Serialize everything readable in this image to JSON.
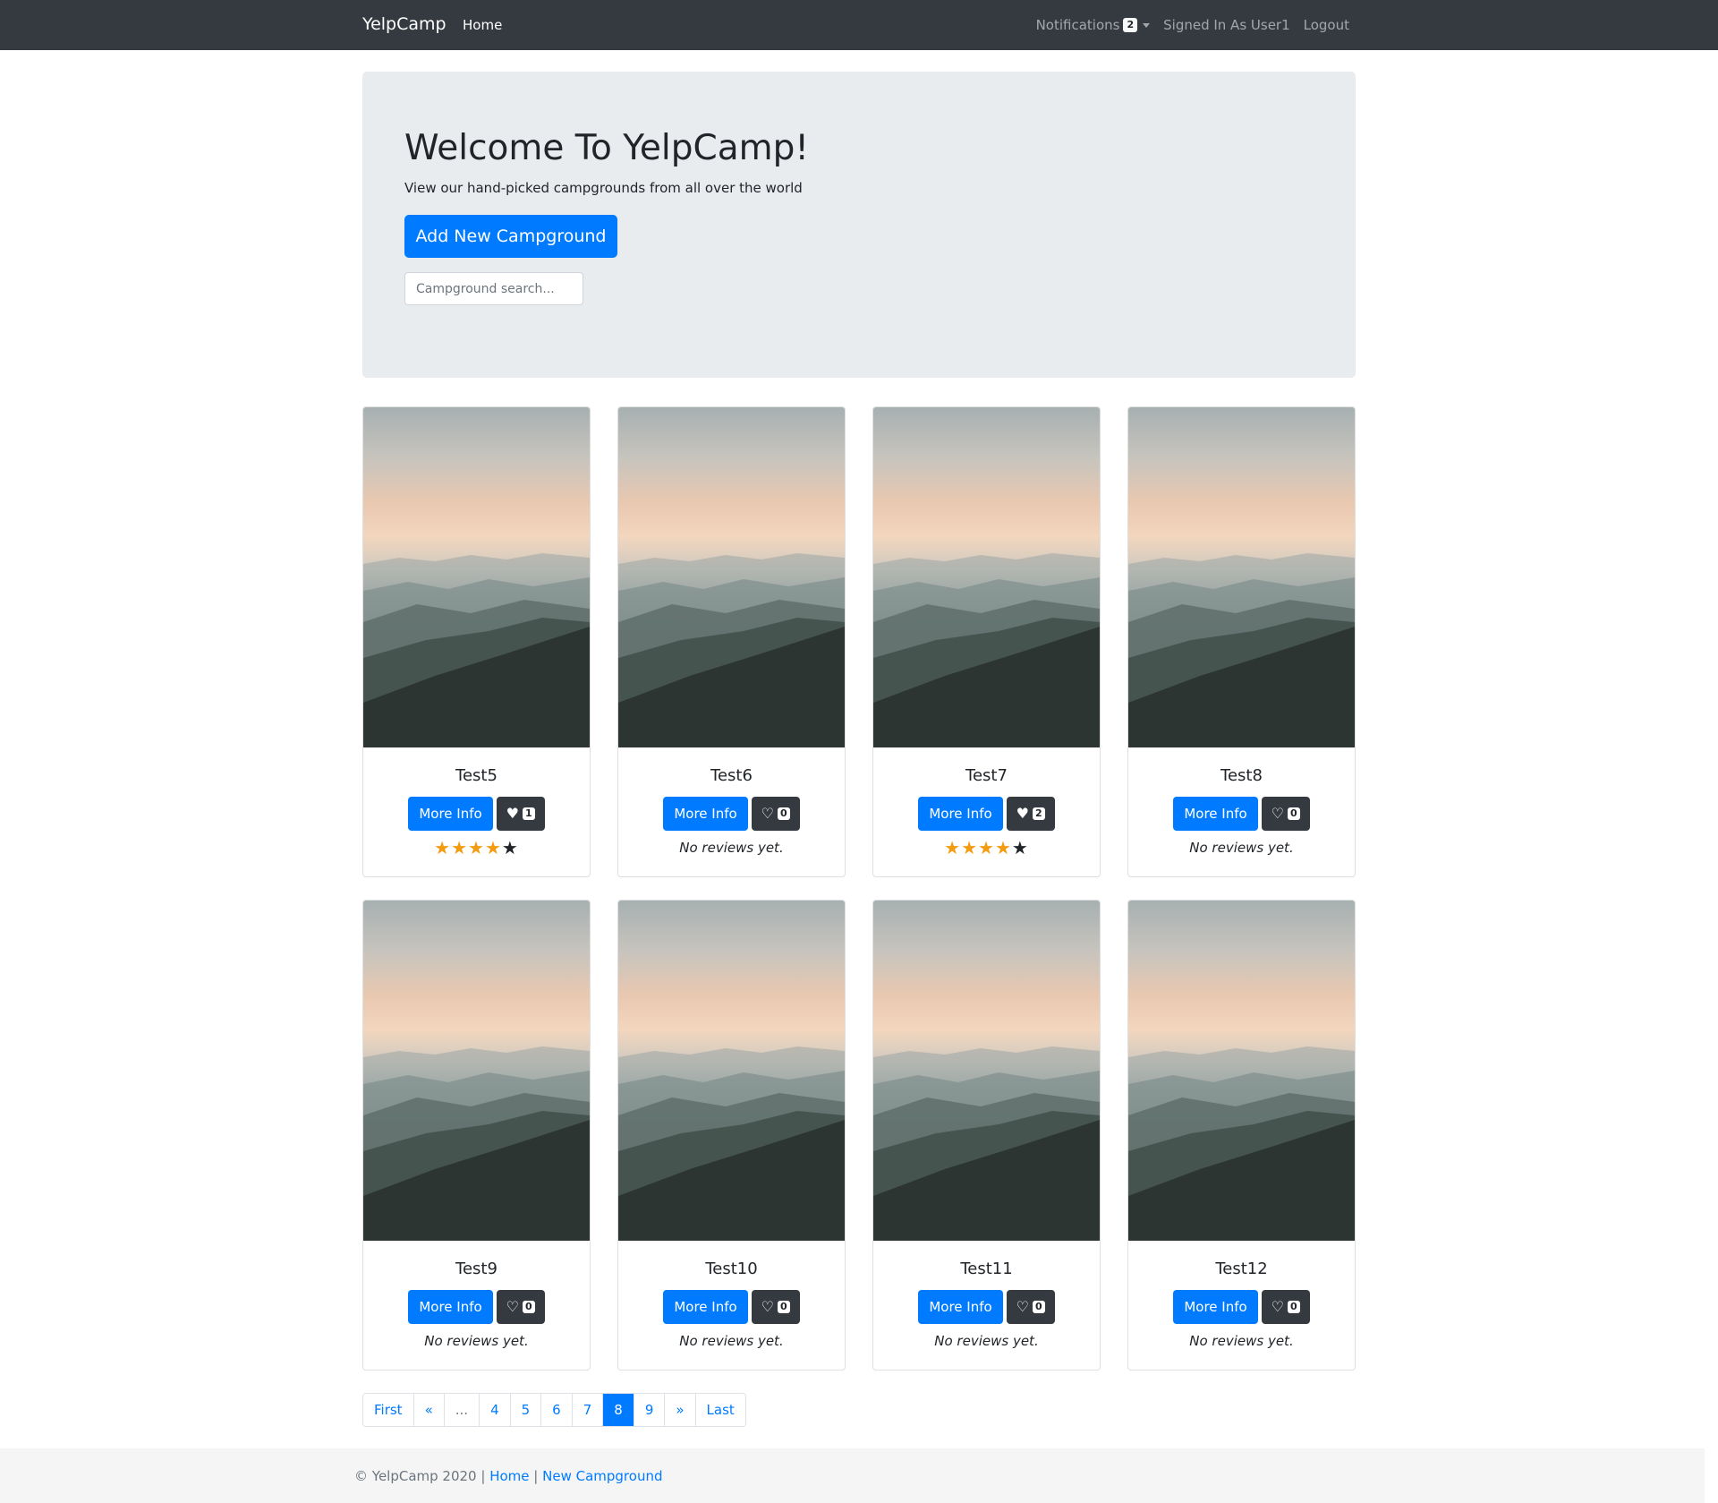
{
  "navbar": {
    "brand": "YelpCamp",
    "home": "Home",
    "notifications": "Notifications",
    "notification_count": "2",
    "signed_in": "Signed In As User1",
    "logout": "Logout"
  },
  "hero": {
    "title": "Welcome To YelpCamp!",
    "subtitle": "View our hand-picked campgrounds from all over the world",
    "add_button": "Add New Campground",
    "search_placeholder": "Campground search..."
  },
  "cards": [
    {
      "title": "Test5",
      "more_info": "More Info",
      "likes": "1",
      "liked": true,
      "rating": 4,
      "reviews_text": null
    },
    {
      "title": "Test6",
      "more_info": "More Info",
      "likes": "0",
      "liked": false,
      "rating": 0,
      "reviews_text": "No reviews yet."
    },
    {
      "title": "Test7",
      "more_info": "More Info",
      "likes": "2",
      "liked": true,
      "rating": 4,
      "reviews_text": null
    },
    {
      "title": "Test8",
      "more_info": "More Info",
      "likes": "0",
      "liked": false,
      "rating": 0,
      "reviews_text": "No reviews yet."
    },
    {
      "title": "Test9",
      "more_info": "More Info",
      "likes": "0",
      "liked": false,
      "rating": 0,
      "reviews_text": "No reviews yet."
    },
    {
      "title": "Test10",
      "more_info": "More Info",
      "likes": "0",
      "liked": false,
      "rating": 0,
      "reviews_text": "No reviews yet."
    },
    {
      "title": "Test11",
      "more_info": "More Info",
      "likes": "0",
      "liked": false,
      "rating": 0,
      "reviews_text": "No reviews yet."
    },
    {
      "title": "Test12",
      "more_info": "More Info",
      "likes": "0",
      "liked": false,
      "rating": 0,
      "reviews_text": "No reviews yet."
    }
  ],
  "pagination": {
    "first": "First",
    "prev": "«",
    "ellipsis": "...",
    "pages": [
      "4",
      "5",
      "6",
      "7",
      "8",
      "9"
    ],
    "current": "8",
    "next": "»",
    "last": "Last"
  },
  "footer": {
    "copyright": "© YelpCamp 2020 |",
    "home": "Home",
    "separator": "|",
    "new_campground": "New Campground"
  },
  "colors": {
    "navbar": "#343a40",
    "primary": "#007bff",
    "jumbotron": "#e9ecef",
    "star": "#f39c12"
  }
}
